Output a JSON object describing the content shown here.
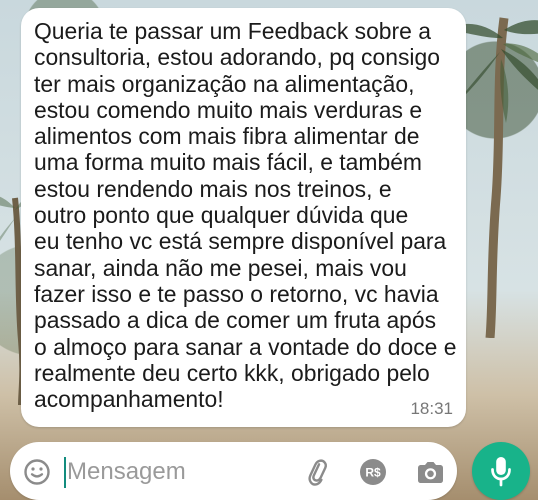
{
  "chat": {
    "message": "Queria te passar um Feedback sobre a\nconsultoria, estou adorando, pq consigo\nter mais organização na alimentação,\nestou comendo muito mais verduras e\nalimentos com mais fibra alimentar de\numa forma muito mais fácil, e também\nestou rendendo mais nos treinos, e\noutro ponto que qualquer dúvida que\neu tenho vc está sempre disponível para\nsanar, ainda não me pesei, mais vou\nfazer isso e te passo o retorno, vc havia\npassado a dica de comer um fruta após\no almoço para sanar a vontade do doce e\nrealmente deu certo kkk, obrigado pelo\nacompanhamento!",
    "time": "18:31"
  },
  "composer": {
    "placeholder": "Mensagem",
    "value": "",
    "icons": {
      "emoji": "emoji-icon",
      "attach": "paperclip-icon",
      "payment": "payment-icon",
      "payment_symbol": "R$",
      "camera": "camera-icon",
      "mic": "microphone-icon"
    }
  },
  "colors": {
    "bubble": "#ffffff",
    "composer": "#ffffff",
    "accent": "#18b38a",
    "icon": "#8b8b8b"
  }
}
